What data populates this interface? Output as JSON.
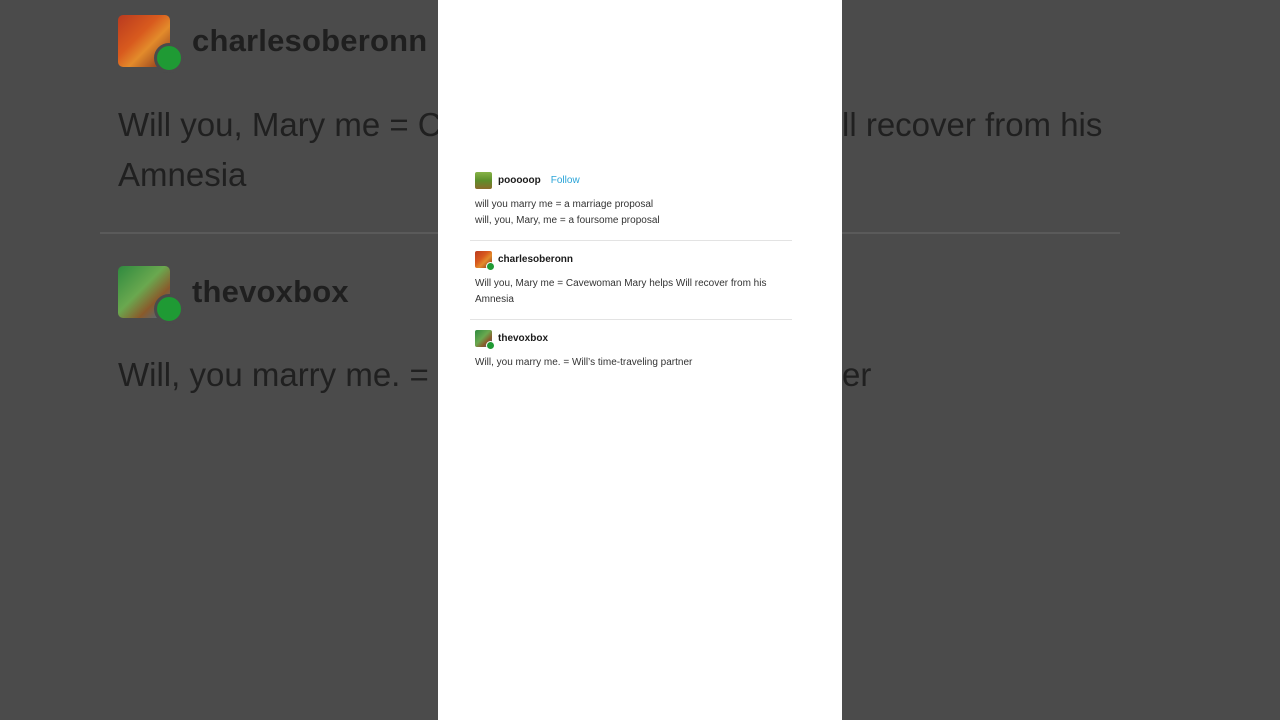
{
  "background": {
    "posts": [
      {
        "username": "charlesoberonn",
        "text": "Will you, Mary me = C",
        "text_tail": "ll recover from his",
        "text_line2": "Amnesia"
      },
      {
        "username": "thevoxbox",
        "text": "Will, you marry me. =",
        "text_tail": "er"
      }
    ]
  },
  "thread": {
    "op": {
      "username": "pooooop",
      "follow_label": "Follow",
      "lines": [
        "will you marry me = a marriage proposal",
        "will, you, Mary, me = a foursome proposal"
      ]
    },
    "replies": [
      {
        "username": "charlesoberonn",
        "text": "Will you, Mary me = Cavewoman Mary helps Will recover from his Amnesia"
      },
      {
        "username": "thevoxbox",
        "text": "Will, you marry me. = Will’s time-traveling partner"
      }
    ]
  },
  "colors": {
    "follow": "#2aa4d8",
    "badge": "#1f9a34",
    "card": "#ffffff",
    "backdrop": "#4b4b4b"
  }
}
